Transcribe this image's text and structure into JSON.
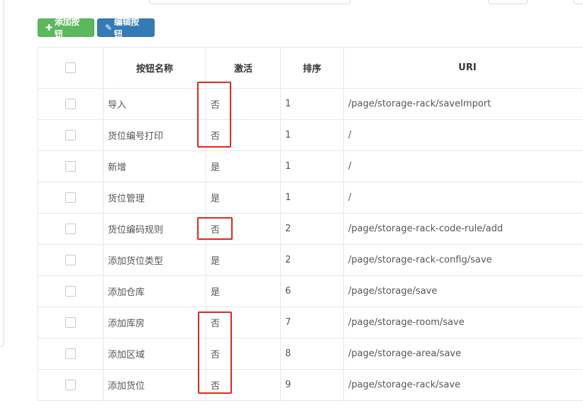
{
  "toolbar": {
    "add_label": "添加按钮",
    "edit_label": "编辑按钮"
  },
  "columns": [
    "按钮名称",
    "激活",
    "排序",
    "URI"
  ],
  "rows": [
    {
      "name": "导入",
      "active": "否",
      "sort": "1",
      "uri": "/page/storage-rack/saveImport"
    },
    {
      "name": "货位编号打印",
      "active": "否",
      "sort": "1",
      "uri": "/"
    },
    {
      "name": "新增",
      "active": "是",
      "sort": "1",
      "uri": "/"
    },
    {
      "name": "货位管理",
      "active": "是",
      "sort": "1",
      "uri": "/"
    },
    {
      "name": "货位编码规则",
      "active": "否",
      "sort": "2",
      "uri": "/page/storage-rack-code-rule/add"
    },
    {
      "name": "添加货位类型",
      "active": "是",
      "sort": "2",
      "uri": "/page/storage-rack-config/save"
    },
    {
      "name": "添加仓库",
      "active": "是",
      "sort": "6",
      "uri": "/page/storage/save"
    },
    {
      "name": "添加库房",
      "active": "否",
      "sort": "7",
      "uri": "/page/storage-room/save"
    },
    {
      "name": "添加区域",
      "active": "否",
      "sort": "8",
      "uri": "/page/storage-area/save"
    },
    {
      "name": "添加货位",
      "active": "否",
      "sort": "9",
      "uri": "/page/storage-rack/save"
    }
  ],
  "colors": {
    "add_button": "#5cb85c",
    "edit_button": "#337ab7",
    "highlight": "#e3261c"
  },
  "icons": {
    "add": "plus-icon",
    "edit": "edit-icon"
  }
}
